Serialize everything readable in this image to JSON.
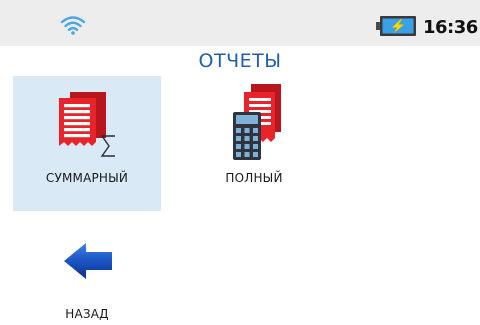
{
  "status_bar": {
    "wifi_icon": "wifi-icon",
    "battery_icon": "battery-charging-icon",
    "time": "16:36"
  },
  "page": {
    "title": "ОТЧЕТЫ"
  },
  "menu": {
    "items": [
      {
        "label": "СУММАРНЫЙ",
        "icon": "receipt-sum-icon",
        "selected": true
      },
      {
        "label": "ПОЛНЫЙ",
        "icon": "receipt-calculator-icon",
        "selected": false
      },
      {
        "label": "НАЗАД",
        "icon": "back-arrow-icon",
        "selected": false
      }
    ]
  },
  "colors": {
    "accent": "#1f5fb0",
    "selection": "#d9eaf6",
    "receipt_red": "#e8232a",
    "arrow_blue": "#1b55c4",
    "battery_fill": "#3aa0e8",
    "bolt_yellow": "#f5d90a"
  }
}
